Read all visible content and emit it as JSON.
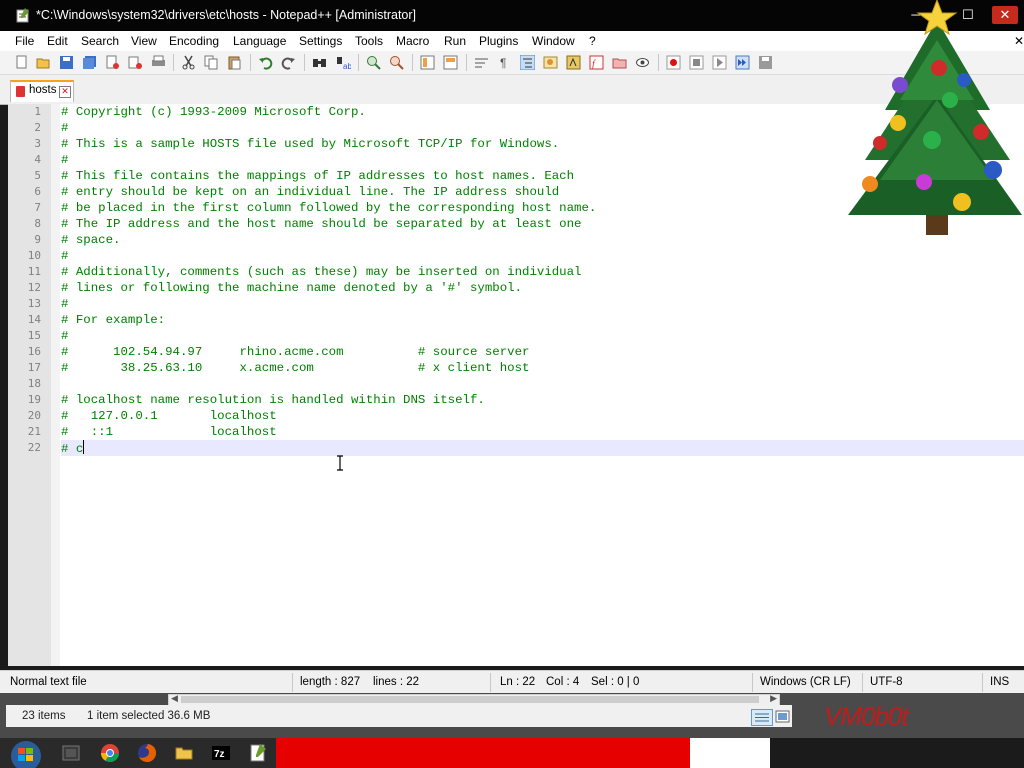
{
  "window": {
    "title": "*C:\\Windows\\system32\\drivers\\etc\\hosts - Notepad++ [Administrator]",
    "minimize_glyph": "─",
    "maximize_glyph": "☐",
    "close_glyph": "✕"
  },
  "menu": [
    "File",
    "Edit",
    "Search",
    "View",
    "Encoding",
    "Language",
    "Settings",
    "Tools",
    "Macro",
    "Run",
    "Plugins",
    "Window",
    "?"
  ],
  "menu_close_glyph": "✕",
  "toolbar": {
    "icons": [
      "new-file-icon",
      "open-file-icon",
      "save-icon",
      "save-all-icon",
      "close-icon",
      "close-all-icon",
      "print-icon",
      "cut-icon",
      "copy-icon",
      "paste-icon",
      "undo-icon",
      "redo-icon",
      "find-icon",
      "replace-icon",
      "zoom-in-icon",
      "zoom-out-icon",
      "sync-vertical-icon",
      "sync-horizontal-icon",
      "word-wrap-icon",
      "show-all-chars-icon",
      "indent-guide-icon",
      "language-udl-icon",
      "document-map-icon",
      "function-list-icon",
      "folder-workspace-icon",
      "monitoring-icon",
      "macro-record-icon",
      "macro-stop-icon",
      "macro-play-icon",
      "macro-run-multiple-icon",
      "macro-save-icon"
    ]
  },
  "tab": {
    "label": "hosts",
    "close_glyph": "✕"
  },
  "editor": {
    "lines": [
      "# Copyright (c) 1993-2009 Microsoft Corp.",
      "#",
      "# This is a sample HOSTS file used by Microsoft TCP/IP for Windows.",
      "#",
      "# This file contains the mappings of IP addresses to host names. Each",
      "# entry should be kept on an individual line. The IP address should",
      "# be placed in the first column followed by the corresponding host name.",
      "# The IP address and the host name should be separated by at least one",
      "# space.",
      "#",
      "# Additionally, comments (such as these) may be inserted on individual",
      "# lines or following the machine name denoted by a '#' symbol.",
      "#",
      "# For example:",
      "#",
      "#      102.54.94.97     rhino.acme.com          # source server",
      "#       38.25.63.10     x.acme.com              # x client host",
      "",
      "# localhost name resolution is handled within DNS itself.",
      "#   127.0.0.1       localhost",
      "#   ::1             localhost",
      "# c"
    ],
    "current_line": 22
  },
  "status": {
    "file_type": "Normal text file",
    "length": "length : 827",
    "lines": "lines : 22",
    "ln": "Ln : 22",
    "col": "Col : 4",
    "sel": "Sel : 0 | 0",
    "eol": "Windows (CR LF)",
    "encoding": "UTF-8",
    "mode": "INS"
  },
  "explorer": {
    "items": "23 items",
    "selected": "1 item selected  36.6 MB"
  },
  "watermark": "VM0b0t",
  "taskbar": {
    "icons": [
      "start-orb-icon",
      "media-center-icon",
      "chrome-icon",
      "firefox-icon",
      "file-explorer-icon",
      "7zip-icon",
      "notepadpp-icon"
    ]
  },
  "colors": {
    "comment_green": "#008000",
    "current_line": "#e8e8ff",
    "line_number": "#808080",
    "close_red": "#c42b1c",
    "tab_accent": "#f7a21b",
    "watermark_red": "#c31b1b"
  }
}
